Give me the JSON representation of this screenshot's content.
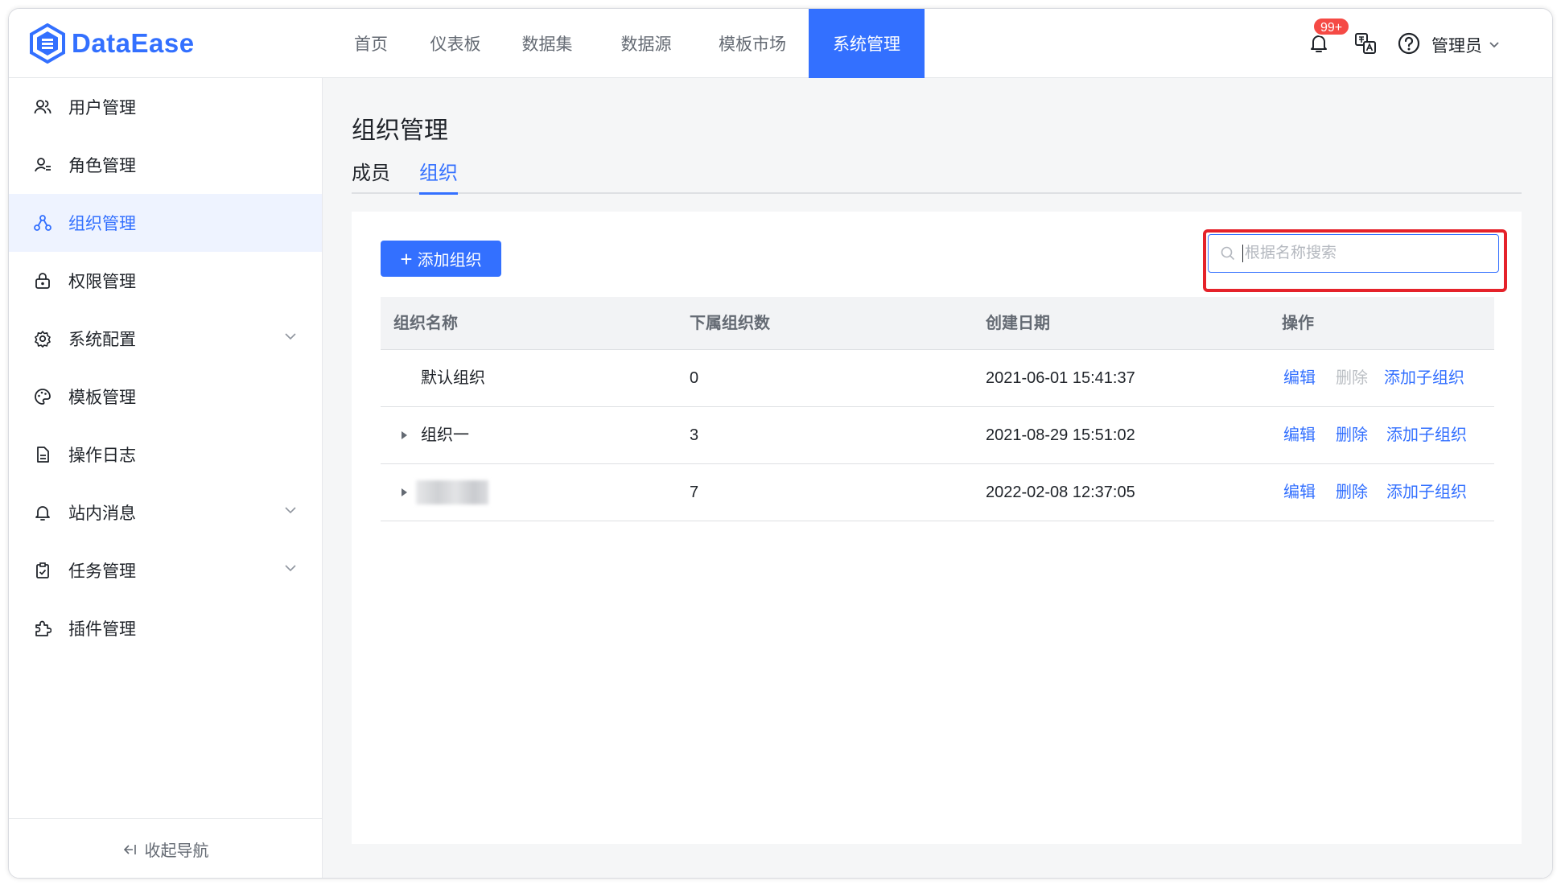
{
  "app": {
    "name": "DataEase",
    "colors": {
      "primary": "#3370ff",
      "danger": "#f54a45",
      "highlight": "#e5222a"
    }
  },
  "header": {
    "nav": [
      {
        "label": "首页"
      },
      {
        "label": "仪表板"
      },
      {
        "label": "数据集"
      },
      {
        "label": "数据源"
      },
      {
        "label": "模板市场"
      },
      {
        "label": "系统管理",
        "active": true
      }
    ],
    "notification_badge": "99+",
    "user": "管理员",
    "icons": [
      "bell-icon",
      "translate-icon",
      "help-icon",
      "chevron-down-icon"
    ]
  },
  "sidebar": {
    "items": [
      {
        "label": "用户管理",
        "icon": "users-icon"
      },
      {
        "label": "角色管理",
        "icon": "role-icon"
      },
      {
        "label": "组织管理",
        "icon": "org-icon",
        "active": true
      },
      {
        "label": "权限管理",
        "icon": "lock-icon"
      },
      {
        "label": "系统配置",
        "icon": "gear-icon",
        "expandable": true
      },
      {
        "label": "模板管理",
        "icon": "palette-icon"
      },
      {
        "label": "操作日志",
        "icon": "document-icon"
      },
      {
        "label": "站内消息",
        "icon": "bell-icon",
        "expandable": true
      },
      {
        "label": "任务管理",
        "icon": "clipboard-icon",
        "expandable": true
      },
      {
        "label": "插件管理",
        "icon": "plugin-icon"
      }
    ],
    "collapse_label": "收起导航"
  },
  "main": {
    "title": "组织管理",
    "tabs": [
      {
        "label": "成员"
      },
      {
        "label": "组织",
        "active": true
      }
    ],
    "add_button": "添加组织",
    "search": {
      "placeholder": "根据名称搜索",
      "value": ""
    },
    "table": {
      "columns": [
        "组织名称",
        "下属组织数",
        "创建日期",
        "操作"
      ],
      "rows": [
        {
          "name": "默认组织",
          "count": "0",
          "created": "2021-06-01 15:41:37",
          "expandable": false,
          "delete_enabled": false
        },
        {
          "name": "组织一",
          "count": "3",
          "created": "2021-08-29 15:51:02",
          "expandable": true,
          "delete_enabled": true
        },
        {
          "name": "",
          "count": "7",
          "created": "2022-02-08 12:37:05",
          "expandable": true,
          "delete_enabled": true,
          "name_redacted": true
        }
      ],
      "actions": {
        "edit": "编辑",
        "delete": "删除",
        "add_child": "添加子组织"
      }
    }
  }
}
